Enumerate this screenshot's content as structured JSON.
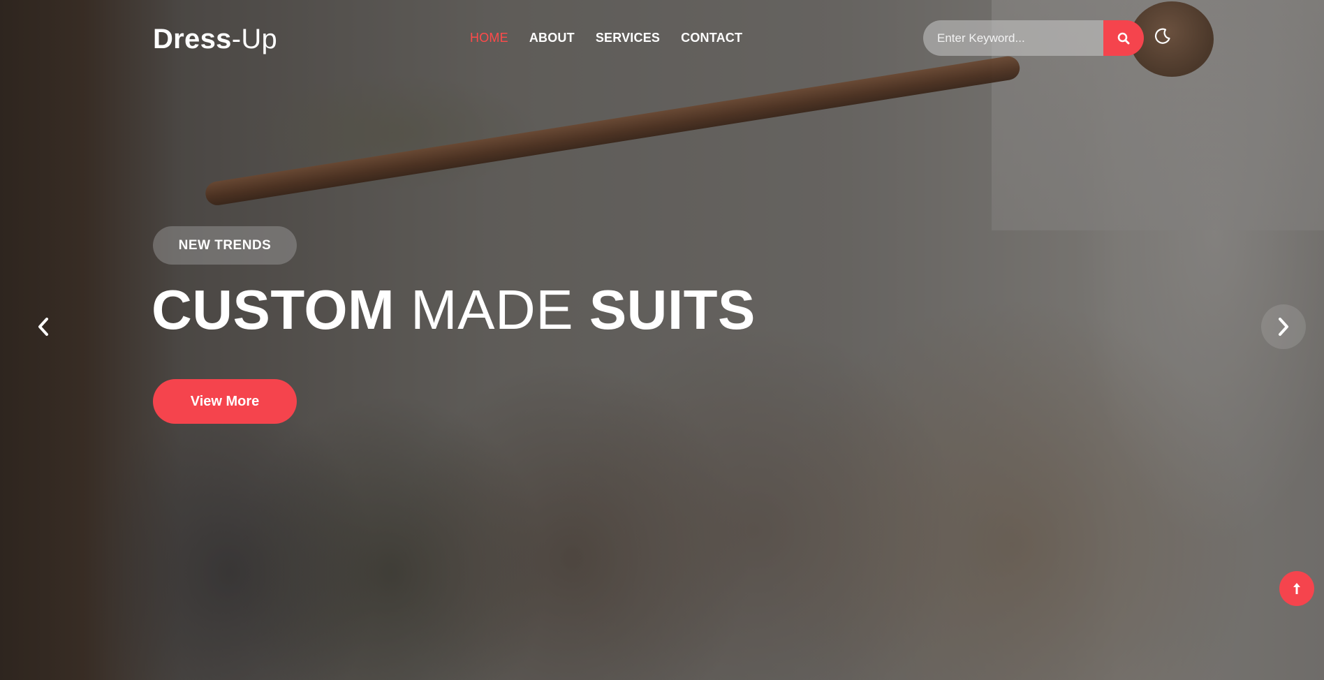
{
  "brand": {
    "bold": "Dress",
    "light": "-Up"
  },
  "nav": {
    "items": [
      {
        "label": "HOME",
        "active": true
      },
      {
        "label": "ABOUT",
        "active": false
      },
      {
        "label": "SERVICES",
        "active": false
      },
      {
        "label": "CONTACT",
        "active": false
      }
    ]
  },
  "search": {
    "placeholder": "Enter Keyword...",
    "icon": "search-icon"
  },
  "theme_toggle": {
    "icon": "moon-icon"
  },
  "hero": {
    "badge": "NEW TRENDS",
    "headline": {
      "part1": "CUSTOM",
      "part2": "MADE",
      "part3": "SUITS"
    },
    "cta_label": "View More"
  },
  "carousel": {
    "prev_icon": "chevron-left-icon",
    "next_icon": "chevron-right-icon"
  },
  "scroll_top": {
    "icon": "arrow-up-icon"
  },
  "colors": {
    "accent": "#f5444d",
    "nav_active": "#ff4a4a",
    "text": "#ffffff"
  }
}
